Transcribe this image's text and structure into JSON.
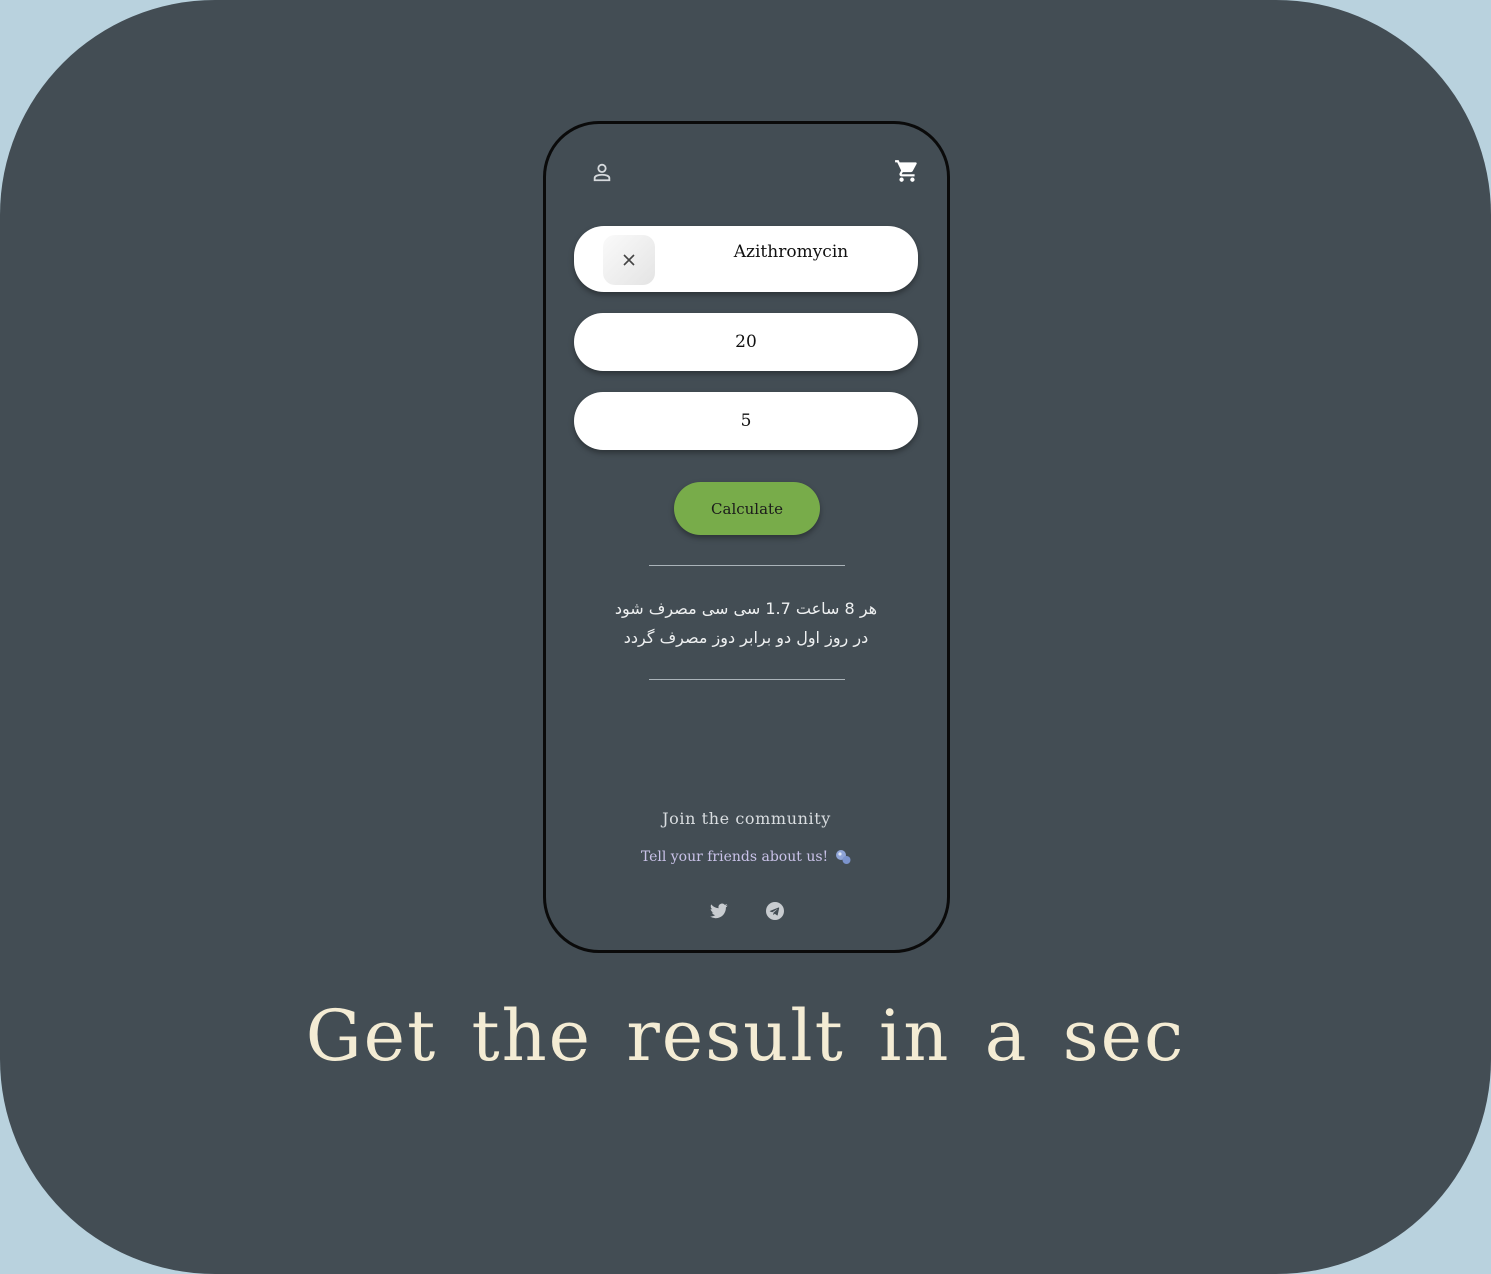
{
  "header": {
    "user_icon": "user-icon",
    "cart_icon": "cart-icon"
  },
  "form": {
    "drug_name": "Azithromycin",
    "clear_icon": "close-icon",
    "dose_value": "20",
    "days_value": "5",
    "calculate_label": "Calculate"
  },
  "result": {
    "line1": "هر 8 ساعت 1.7 سی سی مصرف شود",
    "line2": "در روز اول دو برابر دوز مصرف گردد"
  },
  "community": {
    "title": "Join the community",
    "tell_friends": "Tell your friends about us!",
    "emoji_icon": "bubbles-icon",
    "social": [
      "twitter-icon",
      "telegram-icon"
    ]
  },
  "headline": "Get the result in a sec",
  "colors": {
    "page_bg": "#b9d2de",
    "card_bg": "#434d54",
    "accent_green": "#78ac4a",
    "headline": "#f4ecd4",
    "tell_friends": "#c9c2e8"
  }
}
